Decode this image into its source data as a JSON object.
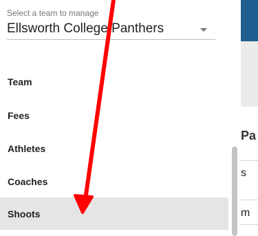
{
  "team_selector": {
    "caption": "Select a team to manage",
    "selected_team": "Ellsworth College Panthers"
  },
  "menu": {
    "items": [
      {
        "label": "Team"
      },
      {
        "label": "Fees"
      },
      {
        "label": "Athletes"
      },
      {
        "label": "Coaches"
      },
      {
        "label": "Shoots"
      }
    ],
    "active_item": "Shoots"
  },
  "background_panel": {
    "title_fragment": "Pa",
    "row_fragments": [
      "s",
      "m"
    ]
  },
  "colors": {
    "header_blue": "#1f5f8f",
    "annotation_arrow": "#ff0000"
  }
}
